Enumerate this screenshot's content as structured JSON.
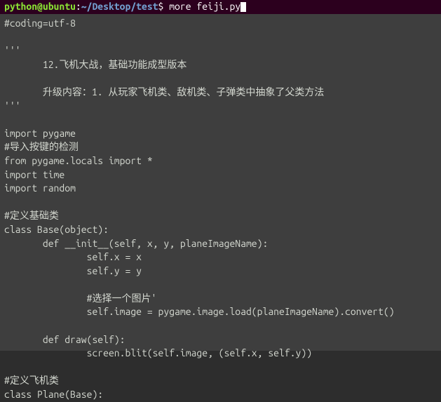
{
  "prompt": {
    "user": "python@ubuntu",
    "sep": ":",
    "path": "~/Desktop/test",
    "dollar": "$",
    "command": "more feiji.py"
  },
  "lines": [
    "#coding=utf-8",
    "",
    "'''",
    "       12.飞机大战，基础功能成型版本",
    "",
    "       升级内容：1. 从玩家飞机类、敌机类、子弹类中抽象了父类方法",
    "'''",
    "",
    "import pygame",
    "#导入按键的检测",
    "from pygame.locals import *",
    "import time",
    "import random",
    "",
    "#定义基础类",
    "class Base(object):",
    "       def __init__(self, x, y, planeImageName):",
    "               self.x = x",
    "               self.y = y",
    "",
    "               #选择一个图片'",
    "               self.image = pygame.image.load(planeImageName).convert()",
    "",
    "       def draw(self):",
    "               screen.blit(self.image, (self.x, self.y))",
    "",
    "#定义飞机类",
    "class Plane(Base):"
  ]
}
